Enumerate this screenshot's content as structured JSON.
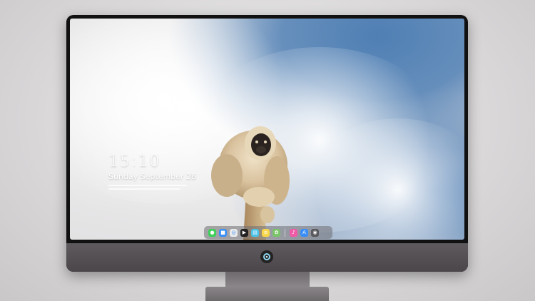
{
  "lock_screen": {
    "time": "15:10",
    "date": "Sunday September 28"
  },
  "dock": {
    "icons": [
      {
        "name": "messages-icon",
        "color": "#3ecf5a"
      },
      {
        "name": "finder-icon",
        "color": "#3b8ff5"
      },
      {
        "name": "safari-icon",
        "color": "#e9e9e9"
      },
      {
        "name": "claquette-icon",
        "color": "#222222"
      },
      {
        "name": "files-icon",
        "color": "#4bc3e8"
      },
      {
        "name": "notes-icon",
        "color": "#f7d64a"
      },
      {
        "name": "photos-icon",
        "color": "#7cc46a"
      },
      {
        "name": "music-icon",
        "color": "#f05ba8"
      },
      {
        "name": "app-store-icon",
        "color": "#3a8ef6"
      },
      {
        "name": "camera-icon",
        "color": "#5a5a5e"
      }
    ]
  },
  "colors": {
    "sky": "#4f7fb4",
    "bezel": "#111111",
    "chin": "#5e5a5e"
  }
}
